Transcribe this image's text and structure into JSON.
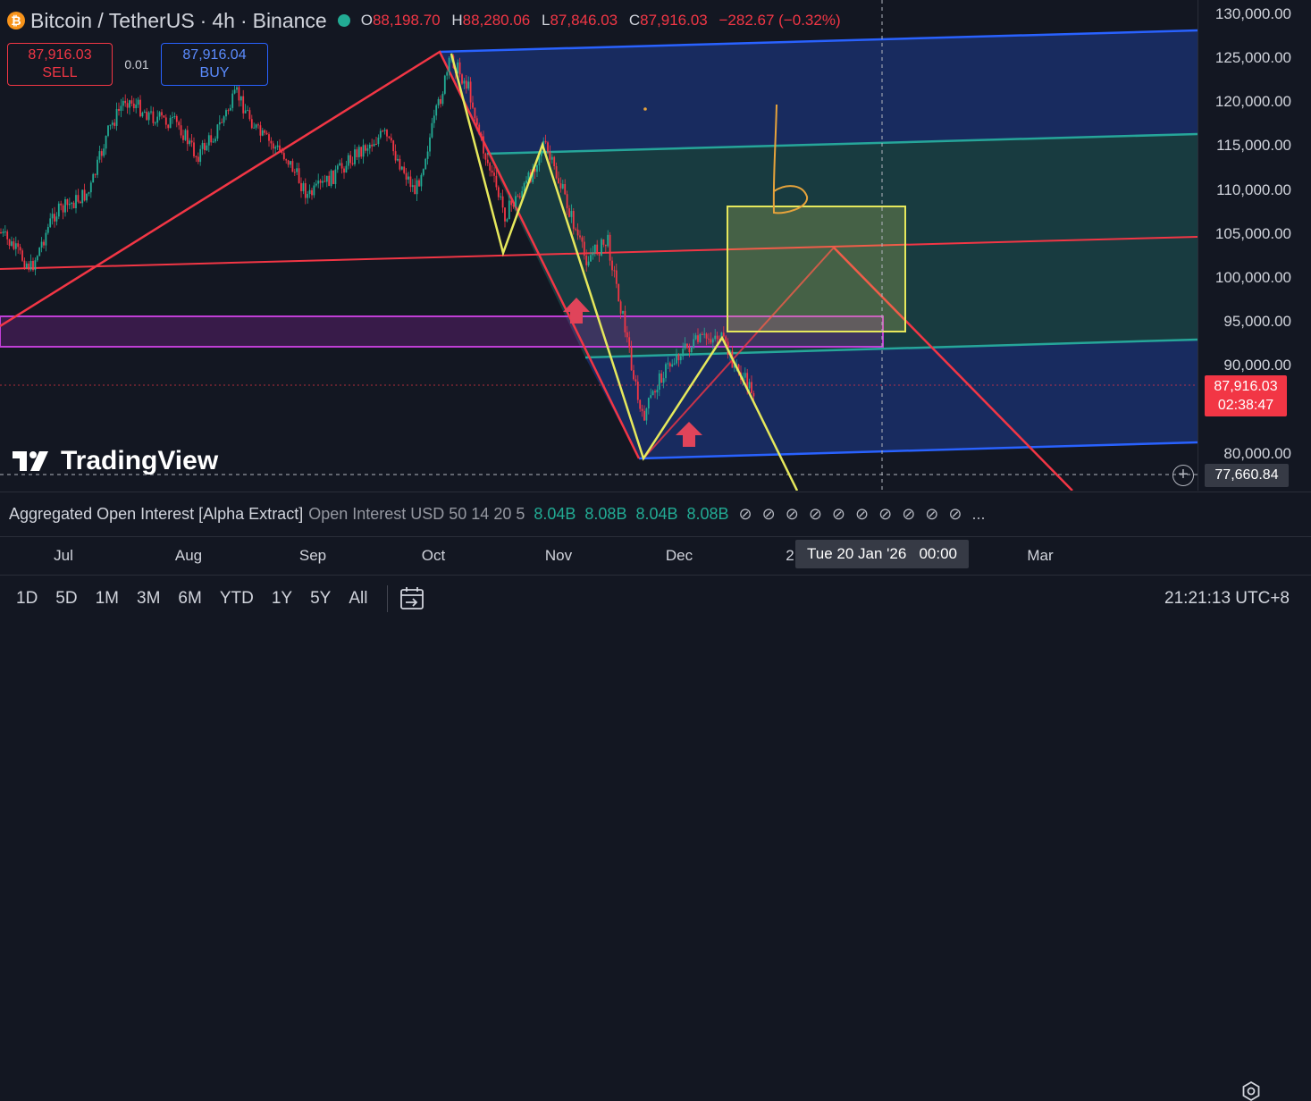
{
  "header": {
    "symbol": "Bitcoin / TetherUS",
    "interval": "4h",
    "exchange": "Binance",
    "separator": "·",
    "coin_icon": "bitcoin-icon",
    "open_label": "O",
    "open": "88,198.70",
    "high_label": "H",
    "high": "88,280.06",
    "low_label": "L",
    "low": "87,846.03",
    "close_label": "C",
    "close": "87,916.03",
    "change": "−282.67 (−0.32%)"
  },
  "trade": {
    "sell_price": "87,916.03",
    "sell_label": "SELL",
    "quantity": "0.01",
    "buy_price": "87,916.04",
    "buy_label": "BUY"
  },
  "price_axis": {
    "ticks": [
      "130,000.00",
      "125,000.00",
      "120,000.00",
      "115,000.00",
      "110,000.00",
      "105,000.00",
      "100,000.00",
      "95,000.00",
      "90,000.00",
      "80,000.00"
    ],
    "last_price": "87,916.03",
    "countdown": "02:38:47",
    "crosshair_price": "77,660.84"
  },
  "logo": {
    "text": "TradingView"
  },
  "indicator": {
    "name": "Aggregated Open Interest [Alpha Extract]",
    "params": "Open Interest USD 50 14 20 5",
    "values": [
      "8.04B",
      "8.08B",
      "8.04B",
      "8.08B"
    ],
    "empty_symbol": "⊘",
    "more": "..."
  },
  "time_axis": {
    "ticks": [
      "Jul",
      "Aug",
      "Sep",
      "Oct",
      "Nov",
      "Dec",
      "2",
      "Mar"
    ],
    "crosshair_time": "Tue 20 Jan '26   00:00"
  },
  "bottom_bar": {
    "ranges": [
      "1D",
      "5D",
      "1M",
      "3M",
      "6M",
      "YTD",
      "1Y",
      "5Y",
      "All"
    ],
    "clock": "21:21:13 UTC+8"
  },
  "colors": {
    "background": "#131722",
    "up": "#22ab94",
    "down": "#f23645",
    "channel_blue": "#2962ff",
    "channel_teal": "#26a69a",
    "zone_purple": "#9c27b0",
    "target_box": "#e6e85c"
  },
  "chart_data": {
    "type": "candlestick",
    "y_range": [
      76000,
      131000
    ],
    "x_range": [
      "Jun 2025",
      "Mar 2026"
    ],
    "last_price": 87916.03
  }
}
